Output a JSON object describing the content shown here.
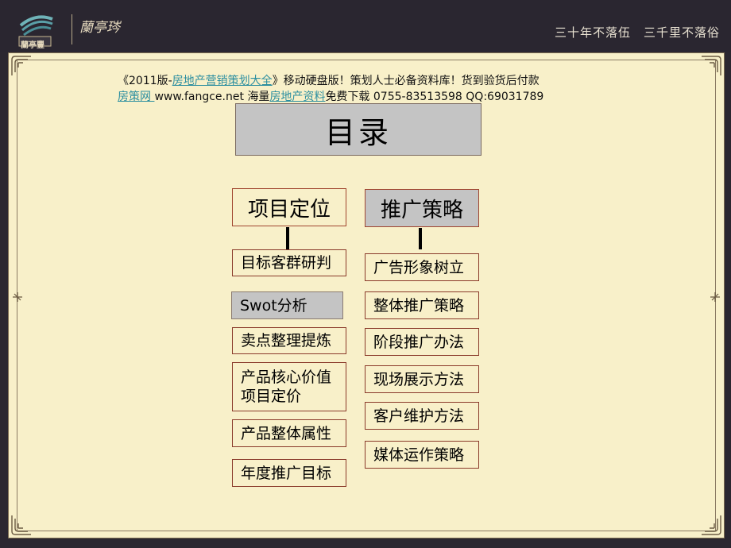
{
  "header": {
    "logo_cn_text": "蘭亭豐",
    "logo_script": "蘭亭琌",
    "slogan": "三十年不落伍　三千里不落俗"
  },
  "notice": {
    "line1_pre": "《2011版-",
    "line1_link": "房地产营销策划大全",
    "line1_post": "》移动硬盘版！策划人士必备资料库！货到验货后付款",
    "line2_link1": "房策网 ",
    "line2_mid": "www.fangce.net  海量",
    "line2_link2": "房地产资料",
    "line2_post": "免费下载   0755-83513598  QQ:69031789"
  },
  "title": "目录",
  "left_column": {
    "heading": "项目定位",
    "items": [
      "目标客群研判",
      "Swot分析",
      "卖点整理提炼",
      "产品核心价值\n项目定价",
      "产品整体属性",
      "年度推广目标"
    ]
  },
  "right_column": {
    "heading": "推广策略",
    "items": [
      "广告形象树立",
      "整体推广策略",
      "阶段推广办法",
      "现场展示方法",
      "客户维护方法",
      "媒体运作策略"
    ]
  },
  "colors": {
    "background": "#2b2730",
    "panel": "#f8f0c9",
    "box_gray": "#c4c4c4",
    "border_accent": "#a0452f",
    "link": "#2b8ea0"
  }
}
